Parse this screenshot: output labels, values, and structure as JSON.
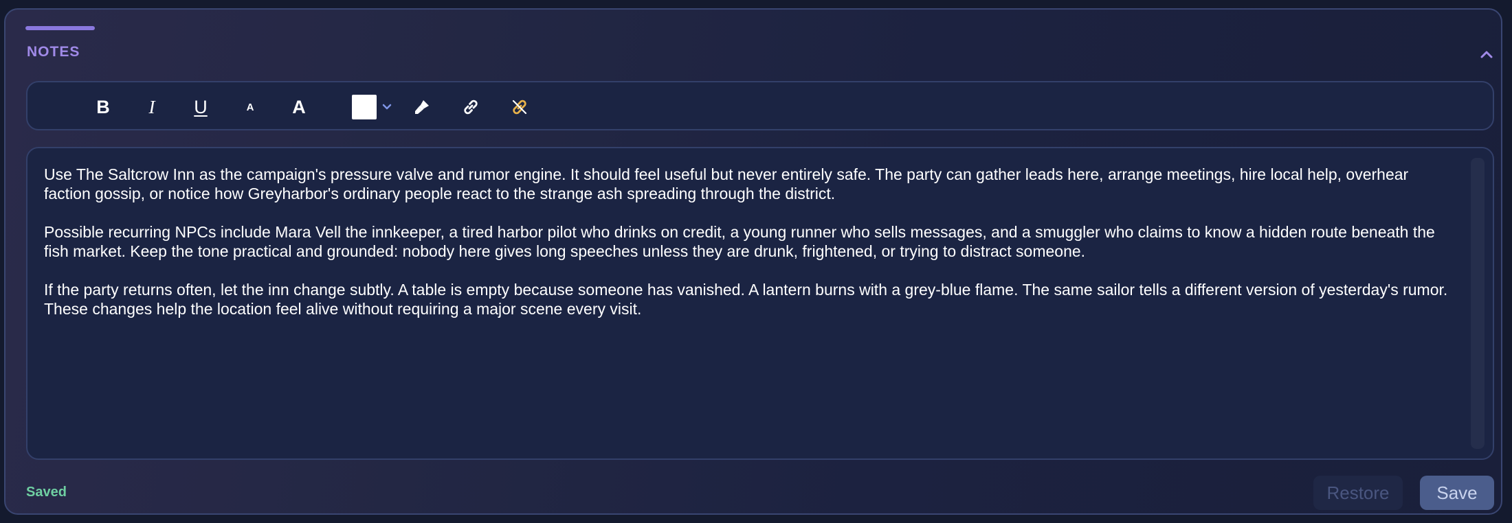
{
  "notes": {
    "title": "NOTES",
    "collapse_icon": "chevron-up-icon"
  },
  "toolbar": {
    "bold_label": "B",
    "italic_label": "I",
    "underline_label": "U",
    "font_size_small_label": "A",
    "font_size_large_label": "A",
    "text_color": "#ffffff",
    "icons": [
      "highlighter-icon",
      "link-icon",
      "unlink-icon"
    ]
  },
  "editor": {
    "paragraphs": [
      "Use The Saltcrow Inn as the campaign's pressure valve and rumor engine. It should feel useful but never entirely safe. The party can gather leads here, arrange meetings, hire local help, overhear faction gossip, or notice how Greyharbor's ordinary people react to the strange ash spreading through the district.",
      "Possible recurring NPCs include Mara Vell the innkeeper, a tired harbor pilot who drinks on credit, a young runner who sells messages, and a smuggler who claims to know a hidden route beneath the fish market. Keep the tone practical and grounded: nobody here gives long speeches unless they are drunk, frightened, or trying to distract someone.",
      "If the party returns often, let the inn change subtly. A table is empty because someone has vanished. A lantern burns with a grey-blue flame. The same sailor tells a different version of yesterday's rumor. These changes help the location feel alive without requiring a major scene every visit."
    ]
  },
  "footer": {
    "status": "Saved",
    "restore_label": "Restore",
    "save_label": "Save"
  },
  "colors": {
    "accent": "#8a78de",
    "status": "#6fcfa2",
    "save_button": "#4b5d8c"
  }
}
